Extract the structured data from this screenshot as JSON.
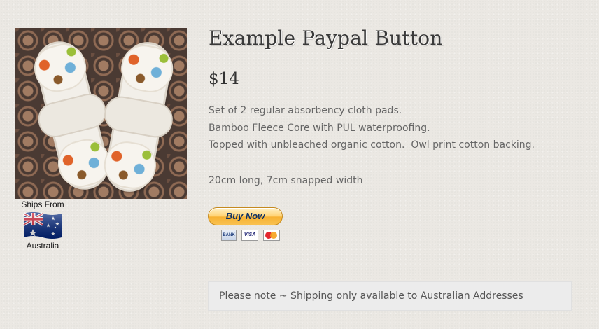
{
  "product": {
    "title": "Example Paypal Button",
    "price": "$14",
    "description_lines": [
      "Set of 2 regular absorbency cloth pads.",
      "Bamboo Fleece Core with PUL waterproofing.",
      "Topped with unbleached organic cotton.  Owl print cotton backing."
    ],
    "dimensions": "20cm long, 7cm snapped width"
  },
  "shipping": {
    "ships_from_label": "Ships From",
    "country": "Australia",
    "flag_icon": "australia-flag-icon"
  },
  "paypal": {
    "button_label": "Buy Now",
    "cards": [
      "BANK",
      "VISA",
      "mastercard"
    ]
  },
  "note": "Please note ~ Shipping only available to Australian Addresses",
  "colors": {
    "background": "#ebe8e3",
    "title": "#3a3a3a",
    "body_text": "#666666",
    "paypal_gold": "#f7b233",
    "paypal_text": "#0b2f66",
    "note_bg": "#ececec"
  }
}
